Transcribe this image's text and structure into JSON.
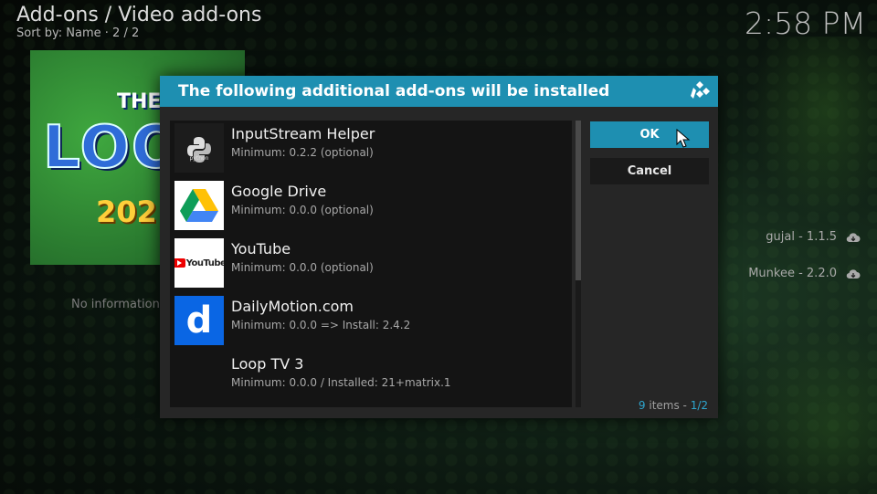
{
  "header": {
    "title": "Add-ons / Video add-ons",
    "sort": "Sort by: Name  ·  2 / 2",
    "clock": "2:58 PM"
  },
  "poster": {
    "line1": "THE",
    "line2": "LOO",
    "line3": "202"
  },
  "left_info": "No information a",
  "side_items": [
    {
      "label": "gujal - 1.1.5",
      "icon": "cloud-download-icon"
    },
    {
      "label": "Munkee - 2.2.0",
      "icon": "cloud-download-icon"
    }
  ],
  "dialog": {
    "title": "The following additional add-ons will be installed",
    "ok_label": "OK",
    "cancel_label": "Cancel",
    "count_num": "9",
    "count_text": " items - ",
    "count_page": "1/2",
    "items": [
      {
        "name": "InputStream Helper",
        "detail": "Minimum: 0.2.2 (optional)",
        "icon": "python-icon"
      },
      {
        "name": "Google Drive",
        "detail": "Minimum: 0.0.0 (optional)",
        "icon": "google-drive-icon"
      },
      {
        "name": "YouTube",
        "detail": "Minimum: 0.0.0 (optional)",
        "icon": "youtube-icon",
        "icon_text": "YouTube"
      },
      {
        "name": "DailyMotion.com",
        "detail": "Minimum: 0.0.0 => Install: 2.4.2",
        "icon": "dailymotion-icon",
        "icon_text": "d"
      },
      {
        "name": "Loop TV 3",
        "detail": "Minimum: 0.0.0 / Installed: 21+matrix.1",
        "icon": "none"
      }
    ]
  },
  "colors": {
    "accent": "#1e8fb1",
    "dialog_bg": "#262626",
    "list_bg": "#141414"
  }
}
